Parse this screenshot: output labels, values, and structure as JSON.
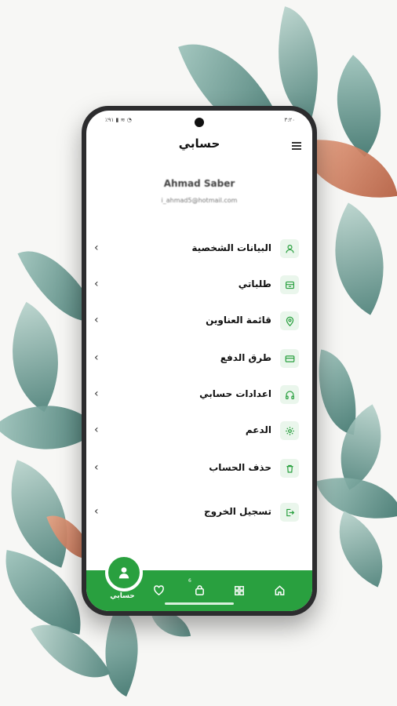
{
  "statusbar": {
    "time": "٣:٢٠",
    "icons": "٪٩١ ▮ ≋ ◔"
  },
  "header": {
    "title": "حسابي"
  },
  "profile": {
    "name": "Ahmad Saber",
    "email": "i_ahmad5@hotmail.com"
  },
  "menu": [
    {
      "label": "البيانات الشخصية",
      "icon": "person-icon"
    },
    {
      "label": "طلباتي",
      "icon": "orders-box-icon"
    },
    {
      "label": "قائمة العناوين",
      "icon": "location-pin-icon"
    },
    {
      "label": "طرق الدفع",
      "icon": "credit-card-icon"
    },
    {
      "label": "اعدادات حسابي",
      "icon": "headphones-icon"
    },
    {
      "label": "الدعم",
      "icon": "gear-icon"
    },
    {
      "label": "حذف الحساب",
      "icon": "trash-icon"
    },
    {
      "label": "تسجيل الخروج",
      "icon": "logout-icon"
    }
  ],
  "bottom_nav": {
    "active_label": "حسابي",
    "cart_badge": "6"
  },
  "colors": {
    "accent": "#29a03f",
    "icon_bg": "#eaf6ec"
  }
}
